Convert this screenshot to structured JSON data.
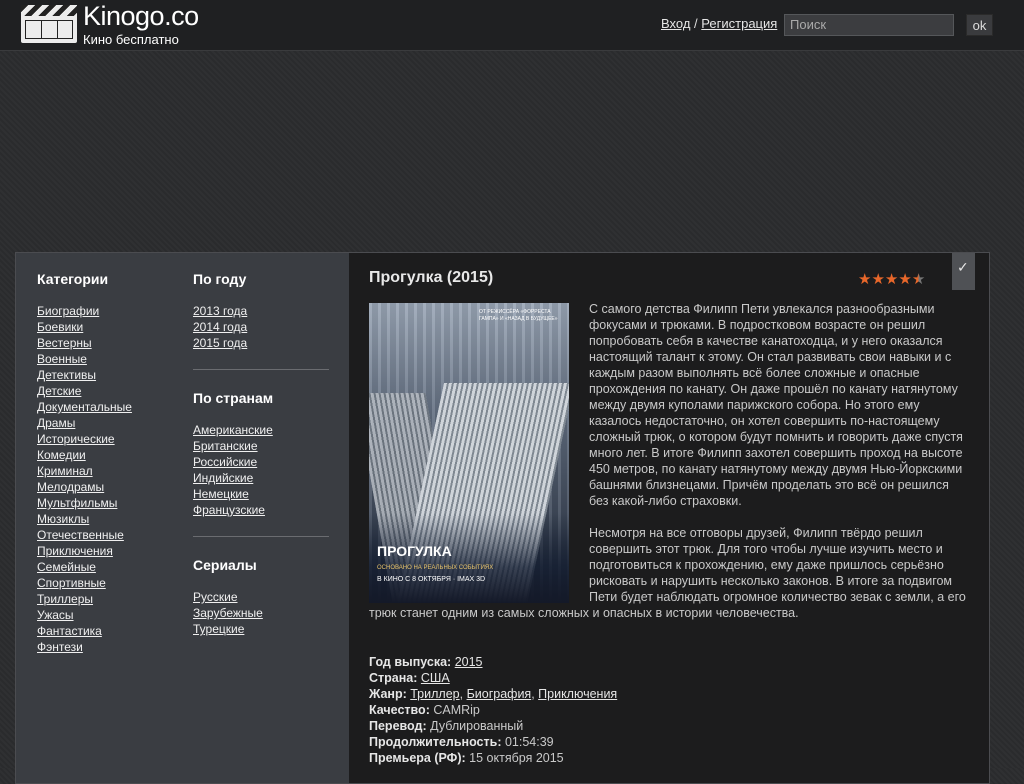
{
  "header": {
    "logo_title": "Kinogo.co",
    "logo_subtitle": "Кино бесплатно",
    "login": "Вход",
    "separator": "/",
    "register": "Регистрация",
    "search_placeholder": "Поиск",
    "search_button": "ok"
  },
  "sidebar": {
    "categories_title": "Категории",
    "categories": [
      "Биографии",
      "Боевики",
      "Вестерны",
      "Военные",
      "Детективы",
      "Детские",
      "Документальные",
      "Драмы",
      "Исторические",
      "Комедии",
      "Криминал",
      "Мелодрамы",
      "Мультфильмы",
      "Мюзиклы",
      "Отечественные",
      "Приключения",
      "Семейные",
      "Спортивные",
      "Триллеры",
      "Ужасы",
      "Фантастика",
      "Фэнтези"
    ],
    "by_year_title": "По году",
    "years": [
      "2013 года",
      "2014 года",
      "2015 года"
    ],
    "by_country_title": "По странам",
    "countries": [
      "Американские",
      "Британские",
      "Российские",
      "Индийские",
      "Немецкие",
      "Французские"
    ],
    "series_title": "Сериалы",
    "series": [
      "Русские",
      "Зарубежные",
      "Турецкие"
    ]
  },
  "movie": {
    "title": "Прогулка (2015)",
    "rating_stars": 4.5,
    "rating_max": 5,
    "poster_title": "ПРОГУЛКА",
    "poster_tagline": "ОСНОВАНО НА РЕАЛЬНЫХ СОБЫТИЯХ",
    "poster_date": "В КИНО С 8 ОКТЯБРЯ",
    "poster_format": "IMAX 3D",
    "poster_top": "ОТ РЕЖИССЁРА «ФОРРЕСТА ГАМПА» И «НАЗАД В БУДУЩЕЕ»",
    "description_1": "С самого детства Филипп Пети увлекался разнообразными фокусами и трюками. В подростковом возрасте он решил попробовать себя в качестве канатоходца, и у него оказался настоящий талант к этому. Он стал развивать свои навыки и с каждым разом выполнять всё более сложные и опасные прохождения по канату. Он даже прошёл по канату натянутому между двумя куполами парижского собора. Но этого ему казалось недостаточно, он хотел совершить по-настоящему сложный трюк, о котором будут помнить и говорить даже спустя много лет. В итоге Филипп захотел совершить проход на высоте 450 метров, по канату натянутому между двумя Нью-Йоркскими башнями близнецами. Причём проделать это всё он решился без какой-либо страховки.",
    "description_2": "Несмотря на все отговоры друзей, Филипп твёрдо решил совершить этот трюк. Для того чтобы лучше изучить место и подготовиться к прохождению, ему даже пришлось серьёзно рисковать и нарушить несколько законов. В итоге за подвигом Пети будет наблюдать огромное количество зевак с земли, а его трюк станет одним из самых сложных и опасных в истории человечества.",
    "year_label": "Год выпуска:",
    "year": "2015",
    "country_label": "Страна:",
    "country": "США",
    "genre_label": "Жанр:",
    "genres": [
      "Триллер",
      "Биография",
      "Приключения"
    ],
    "genre_sep": ", ",
    "quality_label": "Качество:",
    "quality": "CAMRip",
    "translation_label": "Перевод:",
    "translation": "Дублированный",
    "duration_label": "Продолжительность:",
    "duration": "01:54:39",
    "premiere_label": "Премьера (РФ):",
    "premiere": "15 октября 2015"
  },
  "colors": {
    "star": "#e8672a",
    "sidebar_bg": "#3a3d42",
    "content_bg": "#1c1c1d"
  }
}
